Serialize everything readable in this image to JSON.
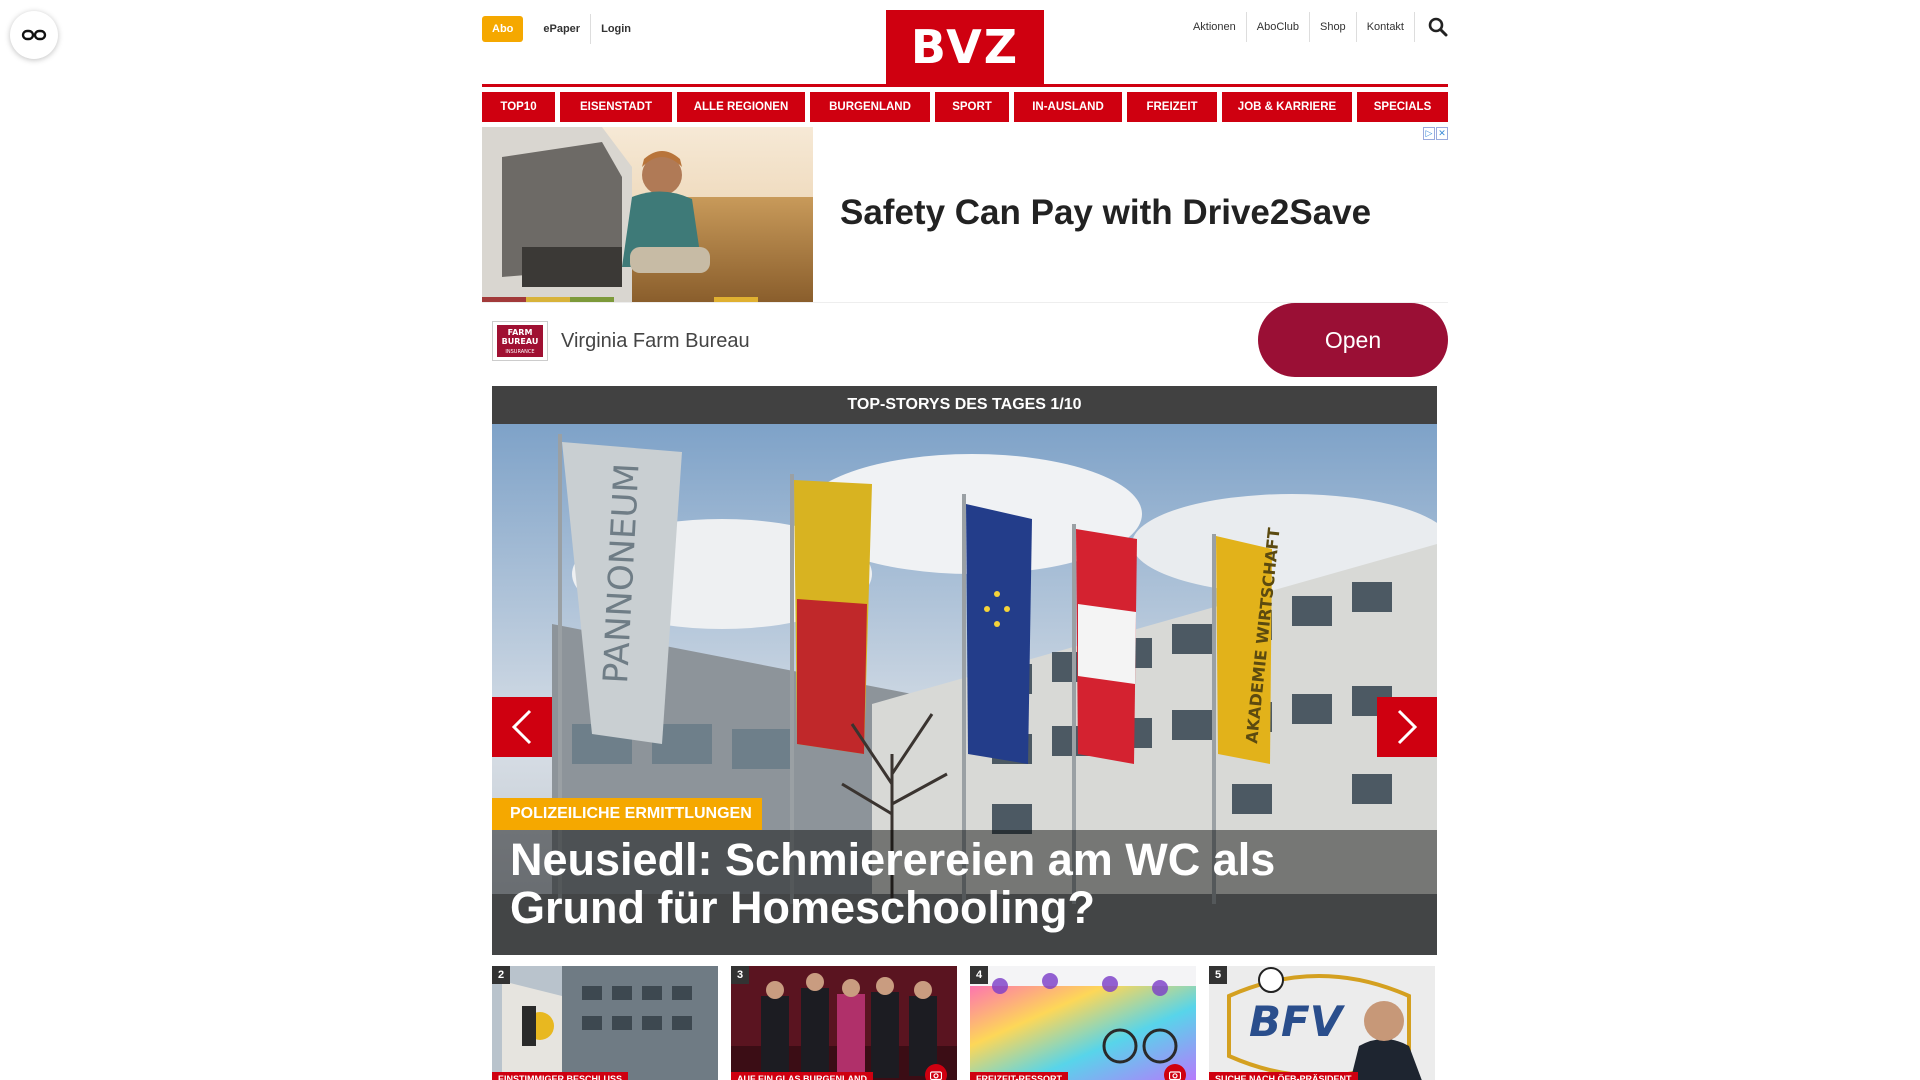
{
  "accessibility": {
    "icon": "glasses-icon"
  },
  "header": {
    "abo": "Abo",
    "left_links": [
      "ePaper",
      "Login"
    ],
    "logo": "BVZ",
    "right_links": [
      "Aktionen",
      "AboClub",
      "Shop",
      "Kontakt"
    ],
    "search_icon": "search-icon"
  },
  "nav": [
    "TOP10",
    "EISENSTADT",
    "ALLE REGIONEN",
    "BURGENLAND",
    "SPORT",
    "IN-AUSLAND",
    "FREIZEIT",
    "JOB & KARRIERE",
    "SPECIALS"
  ],
  "ad": {
    "headline": "Safety Can Pay with Drive2Save",
    "brand": "Virginia Farm Bureau",
    "brand_logo_text": [
      "FARM",
      "BUREAU",
      "INSURANCE"
    ],
    "cta": "Open"
  },
  "stories": {
    "heading": "TOP-STORYS DES TAGES 1/10",
    "hero": {
      "tag": "POLIZEILICHE ERMITTLUNGEN",
      "title": "Neusiedl: Schmierereien am WC als Grund für Homeschooling?",
      "flag_texts": [
        "PANNONEUM",
        "AKADEMIE WIRTSCHAFT"
      ]
    },
    "thumbs": [
      {
        "num": "2",
        "label": "EINSTIMMIGER BESCHLUSS",
        "camera": false
      },
      {
        "num": "3",
        "label": "AUF EIN GLAS BURGENLAND",
        "camera": true
      },
      {
        "num": "4",
        "label": "FREIZEIT-RESSORT",
        "camera": true
      },
      {
        "num": "5",
        "label": "SUCHE NACH ÖFB-PRÄSIDENT",
        "camera": false
      }
    ],
    "thumb5_logo": "BFV"
  },
  "colors": {
    "brand_red": "#cf0010",
    "accent_yellow": "#f5a800",
    "ad_button": "#9a0f35",
    "story_bar": "#414141"
  }
}
